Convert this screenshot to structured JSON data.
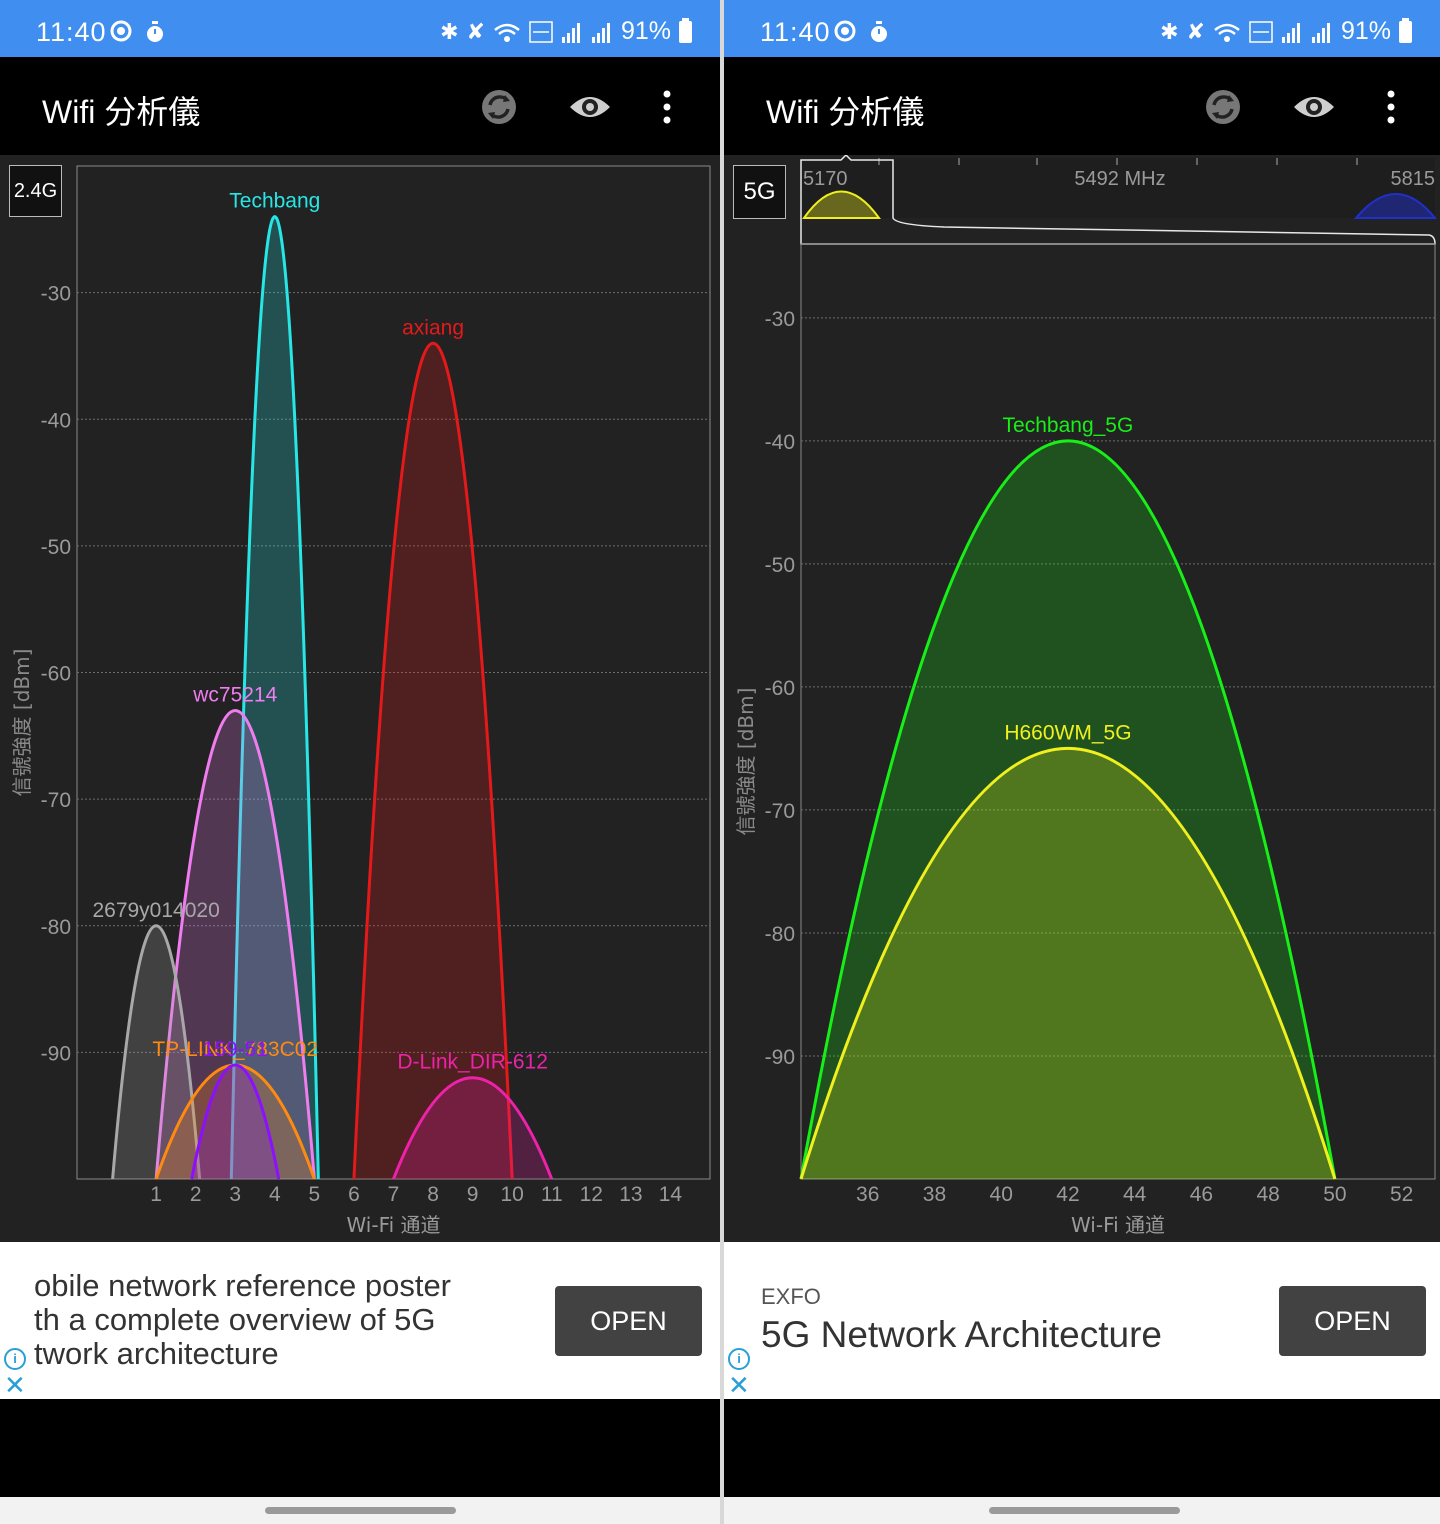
{
  "status_bar": {
    "time": "11:40",
    "battery": "91%",
    "icons": [
      "screen-record-icon",
      "timer-icon",
      "bluetooth-icon",
      "mute-icon",
      "wifi-icon",
      "volte-icon",
      "signal-icon",
      "roaming-signal-icon",
      "battery-icon"
    ]
  },
  "app": {
    "title": "Wifi 分析儀",
    "actions": [
      "refresh-icon",
      "eye-icon",
      "more-vert-icon"
    ]
  },
  "panels": [
    {
      "band_label": "2.4G",
      "chart_data": {
        "type": "area",
        "band": "2.4G",
        "xlabel": "Wi-Fi 通道",
        "ylabel": "信號強度 [dBm]",
        "ylim": [
          -100,
          -20
        ],
        "xlim": [
          -1,
          15
        ],
        "y_ticks": [
          -30,
          -40,
          -50,
          -60,
          -70,
          -80,
          -90
        ],
        "x_ticks": [
          1,
          2,
          3,
          4,
          5,
          6,
          7,
          8,
          9,
          10,
          11,
          12,
          13,
          14
        ],
        "grid": true,
        "series": [
          {
            "name": "Techbang",
            "center": 4,
            "width": 2.2,
            "peak": -24,
            "color": "#28e6e6"
          },
          {
            "name": "axiang",
            "center": 8,
            "width": 4.0,
            "peak": -34,
            "color": "#e41a1a"
          },
          {
            "name": "wc75214",
            "center": 3,
            "width": 4.0,
            "peak": -63,
            "color": "#f07df0"
          },
          {
            "name": "2679y014020",
            "center": 1,
            "width": 2.2,
            "peak": -80,
            "color": "#a8a8a8"
          },
          {
            "name": "TP-LINK_783C02",
            "center": 3,
            "width": 4.0,
            "peak": -91,
            "color": "#ff8a10"
          },
          {
            "name": "159-51",
            "center": 3,
            "width": 2.2,
            "peak": -91,
            "color": "#8c10ff"
          },
          {
            "name": "D-Link_DIR-612",
            "center": 9,
            "width": 4.0,
            "peak": -92,
            "color": "#ee22aa"
          }
        ]
      },
      "ad": {
        "lines": [
          "obile network reference poster",
          "th a complete overview of 5G",
          "twork architecture"
        ],
        "open_label": "OPEN"
      }
    },
    {
      "band_label": "5G",
      "freq_bar": {
        "left": "5170",
        "center": "5492 MHz",
        "right": "5815"
      },
      "chart_data": {
        "type": "area",
        "band": "5G",
        "xlabel": "Wi-Fi 通道",
        "ylabel": "信號強度 [dBm]",
        "ylim": [
          -100,
          -24
        ],
        "xlim": [
          34,
          53
        ],
        "y_ticks": [
          -30,
          -40,
          -50,
          -60,
          -70,
          -80,
          -90
        ],
        "x_ticks": [
          36,
          38,
          40,
          42,
          44,
          46,
          48,
          50,
          52
        ],
        "grid": true,
        "series": [
          {
            "name": "Techbang_5G",
            "center": 42,
            "width": 16,
            "peak": -40,
            "color": "#18ee18"
          },
          {
            "name": "H660WM_5G",
            "center": 42,
            "width": 16,
            "peak": -65,
            "color": "#f0f01e"
          }
        ]
      },
      "ad": {
        "brand": "EXFO",
        "title": "5G Network Architecture",
        "open_label": "OPEN"
      }
    }
  ]
}
